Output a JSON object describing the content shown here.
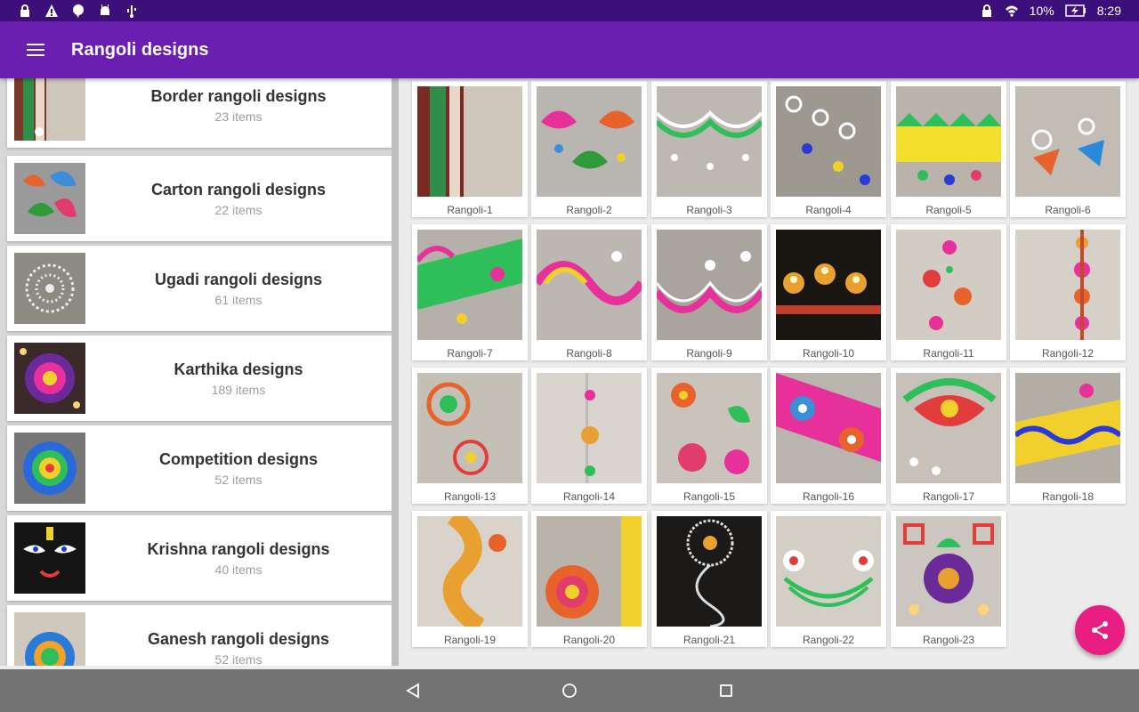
{
  "status_bar": {
    "battery": "10%",
    "time": "8:29",
    "icons_left": [
      "lock-icon",
      "warning-icon",
      "hangouts-icon",
      "android-debug-icon",
      "usb-icon"
    ],
    "icons_right": [
      "lock-icon",
      "wifi-icon",
      "battery-charging-icon"
    ]
  },
  "app_bar": {
    "title": "Rangoli designs",
    "menu_icon": "hamburger-menu-icon",
    "color": "#6a1fb1"
  },
  "categories": [
    {
      "name": "Border rangoli designs",
      "count": "23 items"
    },
    {
      "name": "Carton rangoli designs",
      "count": "22 items"
    },
    {
      "name": "Ugadi rangoli designs",
      "count": "61 items"
    },
    {
      "name": "Karthika designs",
      "count": "189 items"
    },
    {
      "name": "Competition designs",
      "count": "52 items"
    },
    {
      "name": "Krishna rangoli designs",
      "count": "40 items"
    },
    {
      "name": "Ganesh rangoli designs",
      "count": "52 items"
    }
  ],
  "designs": [
    "Rangoli-1",
    "Rangoli-2",
    "Rangoli-3",
    "Rangoli-4",
    "Rangoli-5",
    "Rangoli-6",
    "Rangoli-7",
    "Rangoli-8",
    "Rangoli-9",
    "Rangoli-10",
    "Rangoli-11",
    "Rangoli-12",
    "Rangoli-13",
    "Rangoli-14",
    "Rangoli-15",
    "Rangoli-16",
    "Rangoli-17",
    "Rangoli-18",
    "Rangoli-19",
    "Rangoli-20",
    "Rangoli-21",
    "Rangoli-22",
    "Rangoli-23"
  ],
  "fab": {
    "icon": "share-icon",
    "color": "#e91e82"
  },
  "nav_bar": {
    "icons": [
      "back-icon",
      "home-icon",
      "recents-icon"
    ]
  }
}
